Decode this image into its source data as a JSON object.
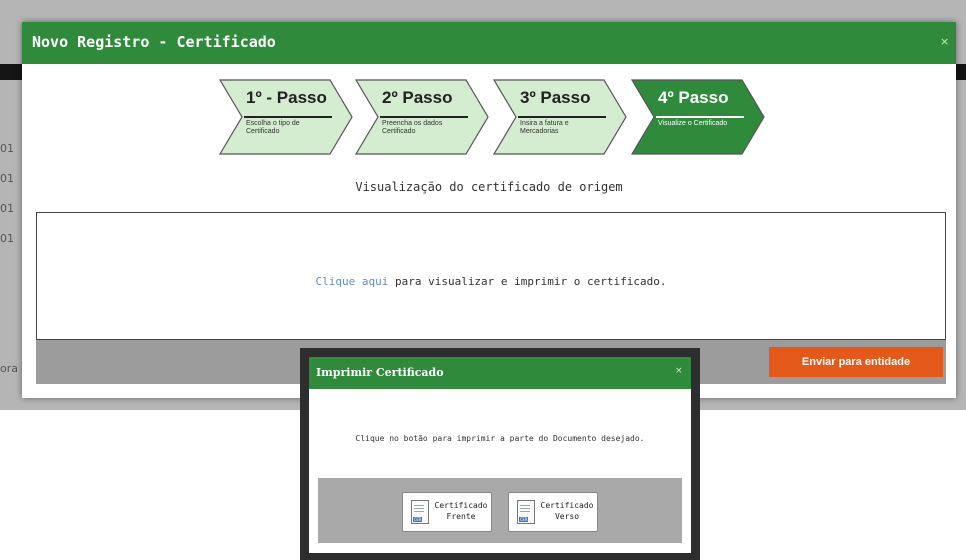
{
  "background": {
    "fragments": [
      "01",
      "01",
      "01",
      "01",
      "ora"
    ]
  },
  "modal": {
    "title": "Novo Registro - Certificado",
    "close": "×",
    "steps": [
      {
        "title": "1º - Passo",
        "desc": "Escolha o tipo de Certificado",
        "active": false
      },
      {
        "title": "2º Passo",
        "desc": "Preencha os dados Certificado",
        "active": false
      },
      {
        "title": "3º Passo",
        "desc": "Insira a fatura e Mercadorias",
        "active": false
      },
      {
        "title": "4º Passo",
        "desc": "Visualize o Certificado",
        "active": true
      }
    ],
    "subtitle": "Visualização do certificado de origem",
    "preview_link": "Clique aqui",
    "preview_rest": " para visualizar e imprimir o certificado.",
    "send_button": "Enviar para entidade"
  },
  "popup": {
    "title": "Imprimir Certificado",
    "close": "×",
    "message": "Clique no botão para imprimir a parte do Documento desejado.",
    "buttons": [
      {
        "line1": "Certificado",
        "line2": "Frente",
        "icon": "certificate-doc-icon"
      },
      {
        "line1": "Certificado",
        "line2": "Verso",
        "icon": "certificate-doc-icon"
      }
    ]
  },
  "colors": {
    "header_green": "#2f8a3c",
    "step_light": "#d4eccf",
    "step_active": "#2f8a3c",
    "send_orange": "#e4591a",
    "link_blue": "#5d8fbf"
  }
}
